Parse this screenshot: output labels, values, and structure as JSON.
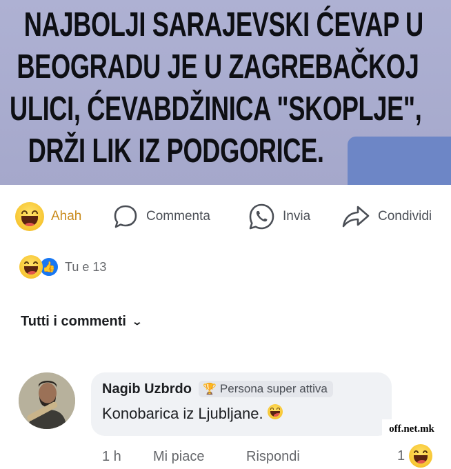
{
  "banner": {
    "lines": [
      "NAJBOLJI SARAJEVSKI ĆEVAP U",
      "BEOGRADU JE U ZAGREBAČKOJ",
      "ULICI, ĆEVABDŽINICA \"SKOPLJE\",",
      "DRŽI LIK IZ PODGORICE."
    ],
    "background_color": "#a7aacd",
    "redaction_color": "#6d86c6"
  },
  "actions": {
    "react_label": "Ahah",
    "comment_label": "Commenta",
    "send_label": "Invia",
    "share_label": "Condividi",
    "react_icon": "haha-emoji-icon",
    "comment_icon": "comment-bubble-icon",
    "send_icon": "whatsapp-icon",
    "share_icon": "share-arrow-icon"
  },
  "reactions_summary": {
    "text": "Tu e 13",
    "icons": [
      "haha-emoji-icon",
      "like-icon"
    ]
  },
  "comments_filter": {
    "label": "Tutti i commenti",
    "icon": "chevron-down-icon"
  },
  "comment": {
    "author": "Nagib Uzbrdo",
    "badge": "Persona super attiva",
    "badge_icon": "trophy-icon",
    "text": "Konobarica iz Ljubljane.",
    "time": "1 h",
    "like_label": "Mi piace",
    "reply_label": "Rispondi",
    "reaction_count": "1"
  },
  "watermark": "off.net.mk",
  "colors": {
    "accent": "#1877f2",
    "haha_label": "#c98a1a",
    "secondary_text": "#65676b"
  }
}
